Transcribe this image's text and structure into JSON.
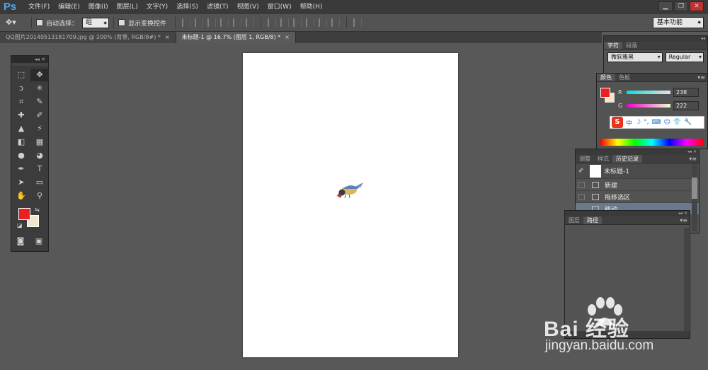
{
  "app": {
    "logo": "Ps"
  },
  "menu": [
    "文件(F)",
    "编辑(E)",
    "图像(I)",
    "图层(L)",
    "文字(Y)",
    "选择(S)",
    "滤镜(T)",
    "视图(V)",
    "窗口(W)",
    "帮助(H)"
  ],
  "window_controls": {
    "minimize": "▁",
    "restore": "❐",
    "close": "✕"
  },
  "options": {
    "auto_select_label": "自动选择：",
    "auto_select_value": "组",
    "show_transform_label": "显示变换控件",
    "workspace": "基本功能"
  },
  "tabs": [
    {
      "label": "QQ图片20140513181709.jpg @ 200% (背景, RGB/8#) *",
      "close": "×"
    },
    {
      "label": "未标题-1 @ 16.7% (图层 1, RGB/8) *",
      "close": "×"
    }
  ],
  "tools": [
    {
      "icon": "marquee-icon",
      "glyph": "⬚"
    },
    {
      "icon": "move-icon",
      "glyph": "✥"
    },
    {
      "icon": "lasso-icon",
      "glyph": "ↄ"
    },
    {
      "icon": "magic-wand-icon",
      "glyph": "✳"
    },
    {
      "icon": "crop-icon",
      "glyph": "⌗"
    },
    {
      "icon": "eyedropper-icon",
      "glyph": "✎"
    },
    {
      "icon": "healing-icon",
      "glyph": "✚"
    },
    {
      "icon": "brush-icon",
      "glyph": "✐"
    },
    {
      "icon": "clone-stamp-icon",
      "glyph": "▲"
    },
    {
      "icon": "history-brush-icon",
      "glyph": "⚡"
    },
    {
      "icon": "eraser-icon",
      "glyph": "◧"
    },
    {
      "icon": "gradient-icon",
      "glyph": "▦"
    },
    {
      "icon": "blur-icon",
      "glyph": "●"
    },
    {
      "icon": "dodge-icon",
      "glyph": "◕"
    },
    {
      "icon": "pen-icon",
      "glyph": "✒"
    },
    {
      "icon": "type-icon",
      "glyph": "T"
    },
    {
      "icon": "path-select-icon",
      "glyph": "➤"
    },
    {
      "icon": "shape-icon",
      "glyph": "▭"
    },
    {
      "icon": "hand-icon",
      "glyph": "✋"
    },
    {
      "icon": "zoom-icon",
      "glyph": "⚲"
    }
  ],
  "colors": {
    "foreground": "#ee1f1f",
    "background": "#f3e6d0",
    "accent": "#4ea6e8"
  },
  "character_panel": {
    "tabs": [
      "字符",
      "段落"
    ],
    "font_family": "微软雅黑",
    "font_style": "Regular"
  },
  "color_panel": {
    "tabs": [
      "颜色",
      "色板"
    ],
    "r_label": "R",
    "r_value": "238",
    "g_label": "G",
    "g_value": "222"
  },
  "ime_bar": {
    "logo": "S",
    "items": [
      "中",
      "☽",
      "°,",
      "⌨",
      "☺",
      "👕",
      "🔧"
    ]
  },
  "history_panel": {
    "tabs": [
      "调整",
      "样式",
      "历史记录"
    ],
    "snapshot": "未标题-1",
    "steps": [
      "新建",
      "拖移选区",
      "移动"
    ]
  },
  "layers_panel": {
    "tabs": [
      "图层",
      "路径"
    ]
  },
  "watermark": {
    "brand": "Bai 经验",
    "site": "jingyan.baidu.com"
  }
}
